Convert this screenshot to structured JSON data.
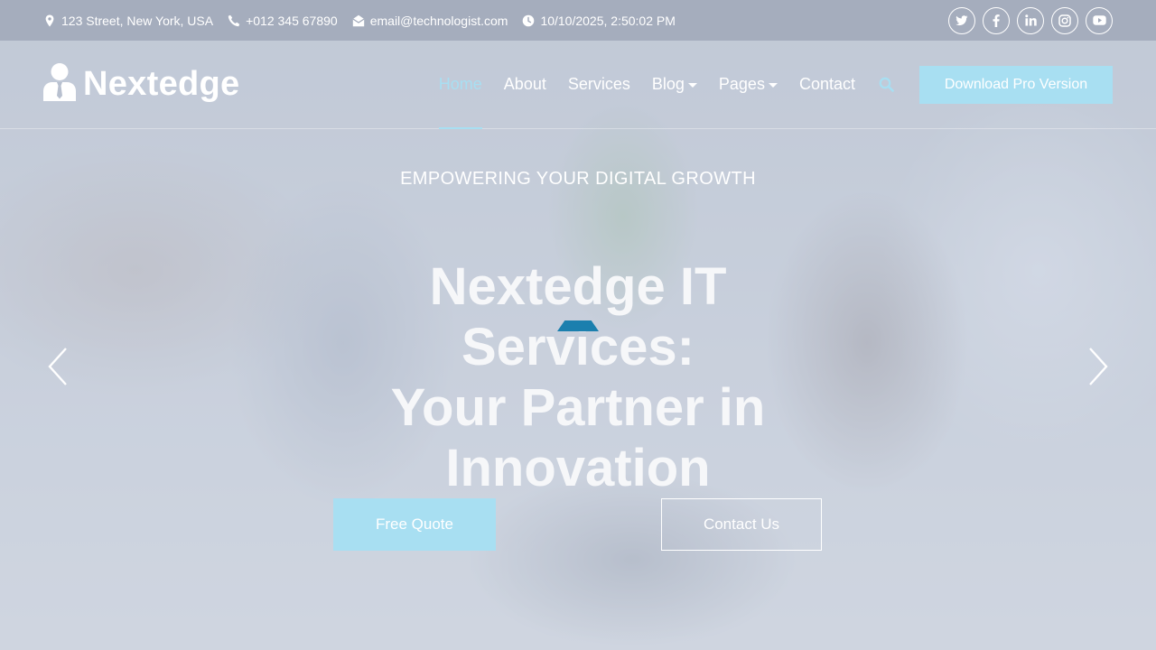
{
  "topbar": {
    "address": "123 Street, New York, USA",
    "phone": "+012 345 67890",
    "email": "email@technologist.com",
    "datetime": "10/10/2025, 2:50:02 PM",
    "icons": {
      "address": "map-pin-icon",
      "phone": "phone-icon",
      "email": "envelope-open-icon",
      "datetime": "clock-icon"
    },
    "socials": [
      "twitter-icon",
      "facebook-icon",
      "linkedin-icon",
      "instagram-icon",
      "youtube-icon"
    ]
  },
  "nav": {
    "brand": "Nextedge",
    "brand_icon": "user-tie-icon",
    "links": [
      {
        "label": "Home",
        "active": true
      },
      {
        "label": "About"
      },
      {
        "label": "Services"
      },
      {
        "label": "Blog",
        "dropdown": true
      },
      {
        "label": "Pages",
        "dropdown": true
      },
      {
        "label": "Contact"
      }
    ],
    "search_icon": "search-icon",
    "download_label": "Download Pro Version"
  },
  "hero": {
    "subtitle": "EMPOWERING YOUR DIGITAL GROWTH",
    "headline_lines": [
      "Nextedge IT Services:",
      "Your Partner in",
      "Innovation"
    ],
    "quote_button": "Free Quote",
    "contact_button": "Contact Us",
    "prev_icon": "chevron-left-icon",
    "next_icon": "chevron-right-icon"
  },
  "colors": {
    "accent": "#a8dff2",
    "accent_dark": "#1b7fae",
    "white": "#ffffff"
  }
}
